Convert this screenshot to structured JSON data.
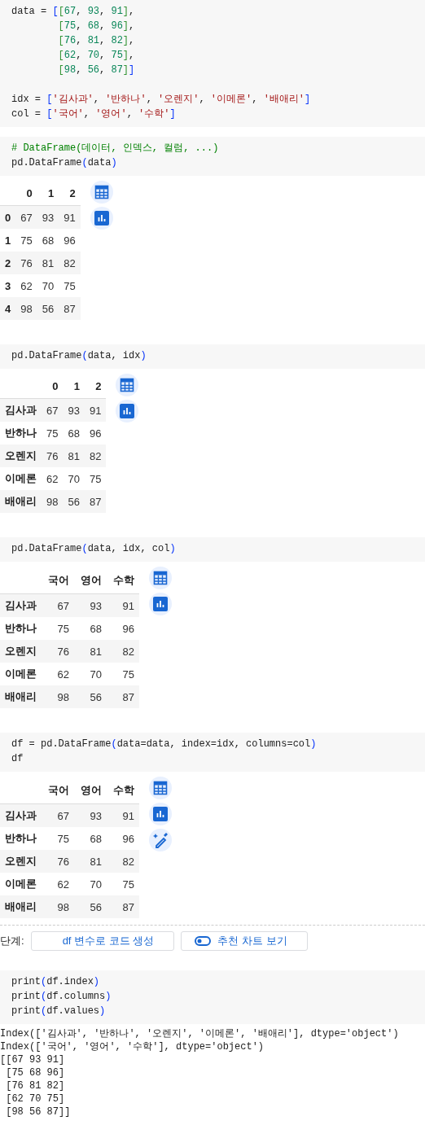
{
  "cells": [
    {
      "kind": "code",
      "code": "data = [[67, 93, 91],\n        [75, 68, 96],\n        [76, 81, 82],\n        [62, 70, 75],\n        [98, 56, 87]]\n\nidx = ['김사과', '반하나', '오렌지', '이메론', '배애리']\ncol = ['국어', '영어', '수학']"
    },
    {
      "kind": "code",
      "code": "# DataFrame(데이터, 인덱스, 컬럼, ...)\npd.DataFrame(data)"
    },
    {
      "kind": "table",
      "columns": [
        "0",
        "1",
        "2"
      ],
      "index": [
        "0",
        "1",
        "2",
        "3",
        "4"
      ],
      "rows": [
        [
          "67",
          "93",
          "91"
        ],
        [
          "75",
          "68",
          "96"
        ],
        [
          "76",
          "81",
          "82"
        ],
        [
          "62",
          "70",
          "75"
        ],
        [
          "98",
          "56",
          "87"
        ]
      ],
      "actions": [
        {
          "kind": "table"
        },
        {
          "kind": "chart"
        }
      ]
    },
    {
      "kind": "code",
      "code": "pd.DataFrame(data, idx)"
    },
    {
      "kind": "table",
      "columns": [
        "0",
        "1",
        "2"
      ],
      "index": [
        "김사과",
        "반하나",
        "오렌지",
        "이메론",
        "배애리"
      ],
      "rows": [
        [
          "67",
          "93",
          "91"
        ],
        [
          "75",
          "68",
          "96"
        ],
        [
          "76",
          "81",
          "82"
        ],
        [
          "62",
          "70",
          "75"
        ],
        [
          "98",
          "56",
          "87"
        ]
      ],
      "actions": [
        {
          "kind": "table"
        },
        {
          "kind": "chart"
        }
      ]
    },
    {
      "kind": "code",
      "code": "pd.DataFrame(data, idx, col)"
    },
    {
      "kind": "table",
      "columns": [
        "국어",
        "영어",
        "수학"
      ],
      "index": [
        "김사과",
        "반하나",
        "오렌지",
        "이메론",
        "배애리"
      ],
      "rows": [
        [
          "67",
          "93",
          "91"
        ],
        [
          "75",
          "68",
          "96"
        ],
        [
          "76",
          "81",
          "82"
        ],
        [
          "62",
          "70",
          "75"
        ],
        [
          "98",
          "56",
          "87"
        ]
      ],
      "actions": [
        {
          "kind": "table"
        },
        {
          "kind": "chart"
        }
      ]
    },
    {
      "kind": "code",
      "code": "df = pd.DataFrame(data=data, index=idx, columns=col)\ndf"
    },
    {
      "kind": "table",
      "columns": [
        "국어",
        "영어",
        "수학"
      ],
      "index": [
        "김사과",
        "반하나",
        "오렌지",
        "이메론",
        "배애리"
      ],
      "rows": [
        [
          "67",
          "93",
          "91"
        ],
        [
          "75",
          "68",
          "96"
        ],
        [
          "76",
          "81",
          "82"
        ],
        [
          "62",
          "70",
          "75"
        ],
        [
          "98",
          "56",
          "87"
        ]
      ],
      "actions": [
        {
          "kind": "table"
        },
        {
          "kind": "chart"
        },
        {
          "kind": "magic"
        }
      ]
    },
    {
      "kind": "next_steps",
      "label": "단계:",
      "buttons": [
        {
          "kind": "code",
          "text": "df 변수로 코드 생성"
        },
        {
          "kind": "toggle",
          "text": "추천 차트 보기"
        }
      ]
    },
    {
      "kind": "code",
      "code": "print(df.index)\nprint(df.columns)\nprint(df.values)"
    },
    {
      "kind": "stream",
      "text": "Index(['김사과', '반하나', '오렌지', '이메론', '배애리'], dtype='object')\nIndex(['국어', '영어', '수학'], dtype='object')\n[[67 93 91]\n [75 68 96]\n [76 81 82]\n [62 70 75]\n [98 56 87]]"
    }
  ]
}
